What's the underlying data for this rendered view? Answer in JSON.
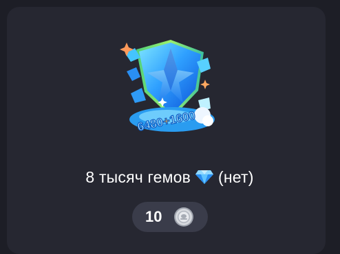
{
  "item": {
    "title_prefix": "8 тысяч гемов",
    "title_suffix": "(нет)",
    "title_icon": "diamond-icon",
    "image_icon": "gem-pack-icon",
    "image_labels": {
      "base": "6480",
      "plus": "+",
      "bonus": "1600"
    }
  },
  "price": {
    "value": "10",
    "currency_icon": "silver-coin-icon"
  },
  "colors": {
    "background": "#1d1e26",
    "card": "#262731",
    "pill": "#3a3c4a",
    "text": "#ffffff",
    "gem_blue": "#3fb3ff"
  }
}
